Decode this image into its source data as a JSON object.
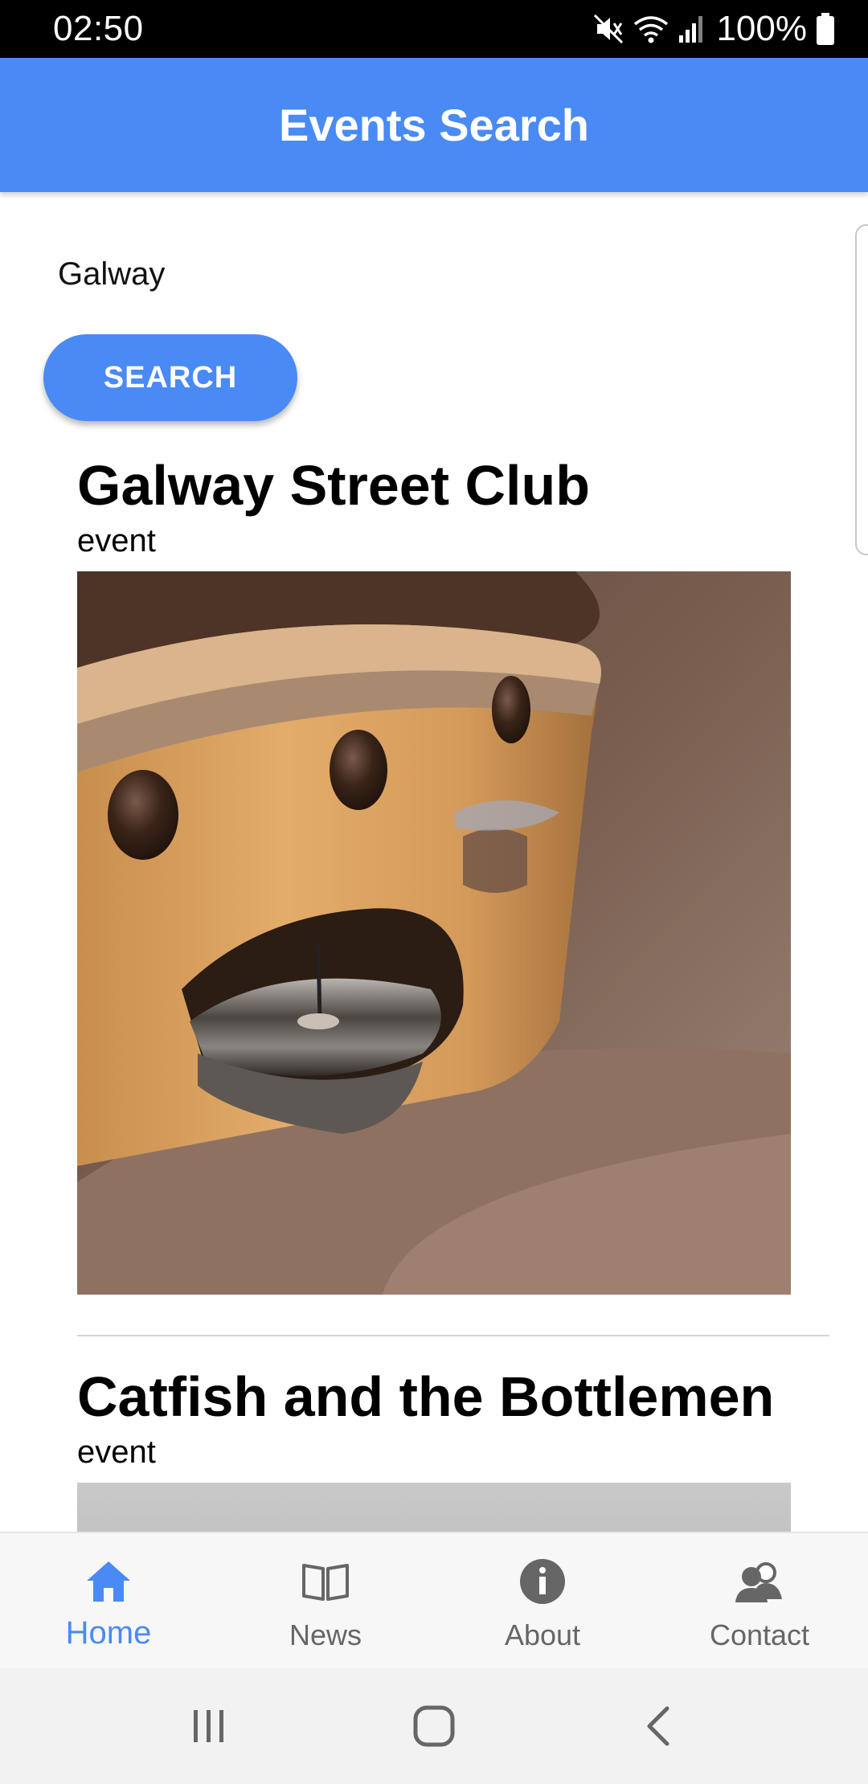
{
  "status_bar": {
    "time": "02:50",
    "battery": "100%"
  },
  "app_bar": {
    "title": "Events Search"
  },
  "search": {
    "value": "Galway",
    "button_label": "SEARCH"
  },
  "events": [
    {
      "title": "Galway Street Club",
      "type": "event",
      "image": "tambourine-photo"
    },
    {
      "title": "Catfish and the Bottlemen",
      "type": "event",
      "image": "gray-photo"
    }
  ],
  "tabs": [
    {
      "label": "Home",
      "icon": "home-icon",
      "active": true
    },
    {
      "label": "News",
      "icon": "book-icon",
      "active": false
    },
    {
      "label": "About",
      "icon": "info-icon",
      "active": false
    },
    {
      "label": "Contact",
      "icon": "people-icon",
      "active": false
    }
  ],
  "colors": {
    "primary": "#4a8af4",
    "inactive": "#666666"
  }
}
